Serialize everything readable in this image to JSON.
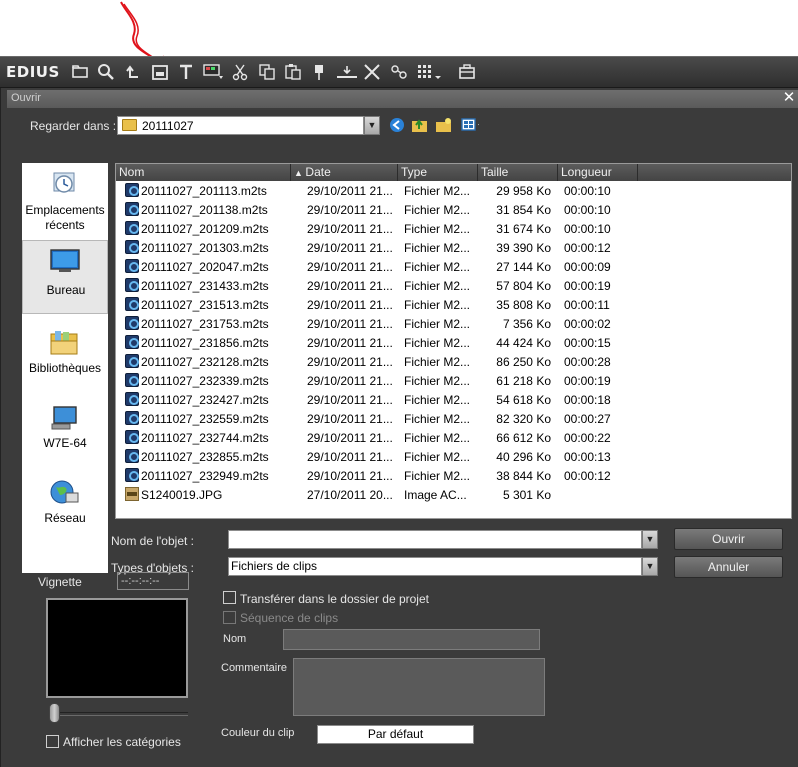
{
  "toolbar": {
    "brand": "EDIUS",
    "icons": [
      "folder-icon",
      "search-icon",
      "undo-icon",
      "save-icon",
      "title-icon",
      "display-icon",
      "cut-icon",
      "copy-icon",
      "paste-icon",
      "marker-icon",
      "insert-icon",
      "delete-icon",
      "split-icon",
      "grid-icon",
      "toolbox-icon"
    ]
  },
  "dialog": {
    "title": "Ouvrir",
    "look_in_label": "Regarder dans :",
    "look_in_value": "20111027",
    "places": [
      {
        "label": "Emplacements récents"
      },
      {
        "label": "Bureau"
      },
      {
        "label": "Bibliothèques"
      },
      {
        "label": "W7E-64"
      },
      {
        "label": "Réseau"
      }
    ],
    "columns": [
      "Nom",
      "Date",
      "Type",
      "Taille",
      "Longueur"
    ],
    "files": [
      {
        "name": "20111027_201113.m2ts",
        "date": "29/10/2011 21...",
        "type": "Fichier M2...",
        "size": "29 958 Ko",
        "length": "00:00:10",
        "kind": "video"
      },
      {
        "name": "20111027_201138.m2ts",
        "date": "29/10/2011 21...",
        "type": "Fichier M2...",
        "size": "31 854 Ko",
        "length": "00:00:10",
        "kind": "video"
      },
      {
        "name": "20111027_201209.m2ts",
        "date": "29/10/2011 21...",
        "type": "Fichier M2...",
        "size": "31 674 Ko",
        "length": "00:00:10",
        "kind": "video"
      },
      {
        "name": "20111027_201303.m2ts",
        "date": "29/10/2011 21...",
        "type": "Fichier M2...",
        "size": "39 390 Ko",
        "length": "00:00:12",
        "kind": "video"
      },
      {
        "name": "20111027_202047.m2ts",
        "date": "29/10/2011 21...",
        "type": "Fichier M2...",
        "size": "27 144 Ko",
        "length": "00:00:09",
        "kind": "video"
      },
      {
        "name": "20111027_231433.m2ts",
        "date": "29/10/2011 21...",
        "type": "Fichier M2...",
        "size": "57 804 Ko",
        "length": "00:00:19",
        "kind": "video"
      },
      {
        "name": "20111027_231513.m2ts",
        "date": "29/10/2011 21...",
        "type": "Fichier M2...",
        "size": "35 808 Ko",
        "length": "00:00:11",
        "kind": "video"
      },
      {
        "name": "20111027_231753.m2ts",
        "date": "29/10/2011 21...",
        "type": "Fichier M2...",
        "size": "7 356 Ko",
        "length": "00:00:02",
        "kind": "video"
      },
      {
        "name": "20111027_231856.m2ts",
        "date": "29/10/2011 21...",
        "type": "Fichier M2...",
        "size": "44 424 Ko",
        "length": "00:00:15",
        "kind": "video"
      },
      {
        "name": "20111027_232128.m2ts",
        "date": "29/10/2011 21...",
        "type": "Fichier M2...",
        "size": "86 250 Ko",
        "length": "00:00:28",
        "kind": "video"
      },
      {
        "name": "20111027_232339.m2ts",
        "date": "29/10/2011 21...",
        "type": "Fichier M2...",
        "size": "61 218 Ko",
        "length": "00:00:19",
        "kind": "video"
      },
      {
        "name": "20111027_232427.m2ts",
        "date": "29/10/2011 21...",
        "type": "Fichier M2...",
        "size": "54 618 Ko",
        "length": "00:00:18",
        "kind": "video"
      },
      {
        "name": "20111027_232559.m2ts",
        "date": "29/10/2011 21...",
        "type": "Fichier M2...",
        "size": "82 320 Ko",
        "length": "00:00:27",
        "kind": "video"
      },
      {
        "name": "20111027_232744.m2ts",
        "date": "29/10/2011 21...",
        "type": "Fichier M2...",
        "size": "66 612 Ko",
        "length": "00:00:22",
        "kind": "video"
      },
      {
        "name": "20111027_232855.m2ts",
        "date": "29/10/2011 21...",
        "type": "Fichier M2...",
        "size": "40 296 Ko",
        "length": "00:00:13",
        "kind": "video"
      },
      {
        "name": "20111027_232949.m2ts",
        "date": "29/10/2011 21...",
        "type": "Fichier M2...",
        "size": "38 844 Ko",
        "length": "00:00:12",
        "kind": "video"
      },
      {
        "name": "S1240019.JPG",
        "date": "27/10/2011 20...",
        "type": "Image AC...",
        "size": "5 301 Ko",
        "length": "",
        "kind": "image"
      }
    ],
    "object_name_label": "Nom de l'objet :",
    "object_name_value": "",
    "object_types_label": "Types d'objets :",
    "object_types_value": "Fichiers de clips",
    "open_button": "Ouvrir",
    "cancel_button": "Annuler",
    "thumbnail_label": "Vignette",
    "thumbnail_timecode": "--:--:--:--",
    "transfer_label": "Transférer dans le dossier de projet",
    "sequence_label": "Séquence de clips",
    "name_label": "Nom",
    "comment_label": "Commentaire",
    "clip_color_label": "Couleur du clip",
    "clip_color_value": "Par défaut",
    "show_categories_label": "Afficher les catégories",
    "transfer_checked": false,
    "sequence_checked": false,
    "show_categories_checked": false
  },
  "colors": {
    "annotation": "#e0131b",
    "dialog_bg": "#3b3b3b",
    "list_bg": "#ffffff"
  }
}
